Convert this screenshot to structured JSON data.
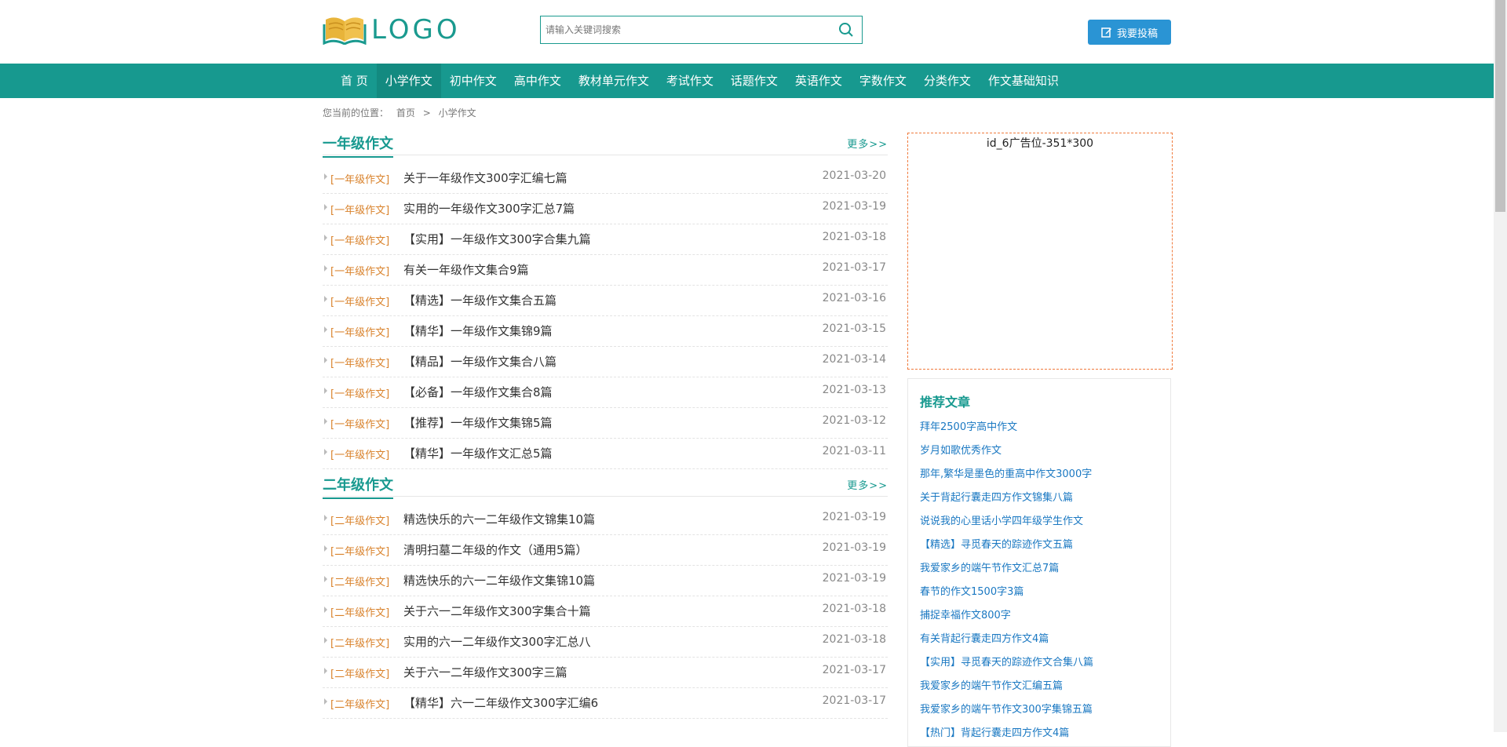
{
  "header": {
    "logo_text": "LOGO",
    "search_placeholder": "请输入关键词搜索",
    "submit_label": "我要投稿"
  },
  "nav": {
    "items": [
      "首 页",
      "小学作文",
      "初中作文",
      "高中作文",
      "教材单元作文",
      "考试作文",
      "话题作文",
      "英语作文",
      "字数作文",
      "分类作文",
      "作文基础知识"
    ],
    "active_index": 1
  },
  "breadcrumb": {
    "prefix": "您当前的位置：",
    "home": "首页",
    "sep": ">",
    "current": "小学作文"
  },
  "sections": [
    {
      "title": "一年级作文",
      "more": "更多>>",
      "tag": "[一年级作文]",
      "items": [
        {
          "title": "关于一年级作文300字汇编七篇",
          "date": "2021-03-20"
        },
        {
          "title": "实用的一年级作文300字汇总7篇",
          "date": "2021-03-19"
        },
        {
          "title": "【实用】一年级作文300字合集九篇",
          "date": "2021-03-18"
        },
        {
          "title": "有关一年级作文集合9篇",
          "date": "2021-03-17"
        },
        {
          "title": "【精选】一年级作文集合五篇",
          "date": "2021-03-16"
        },
        {
          "title": "【精华】一年级作文集锦9篇",
          "date": "2021-03-15"
        },
        {
          "title": "【精品】一年级作文集合八篇",
          "date": "2021-03-14"
        },
        {
          "title": "【必备】一年级作文集合8篇",
          "date": "2021-03-13"
        },
        {
          "title": "【推荐】一年级作文集锦5篇",
          "date": "2021-03-12"
        },
        {
          "title": "【精华】一年级作文汇总5篇",
          "date": "2021-03-11"
        }
      ]
    },
    {
      "title": "二年级作文",
      "more": "更多>>",
      "tag": "[二年级作文]",
      "items": [
        {
          "title": "精选快乐的六一二年级作文锦集10篇",
          "date": "2021-03-19"
        },
        {
          "title": "清明扫墓二年级的作文（通用5篇）",
          "date": "2021-03-19"
        },
        {
          "title": "精选快乐的六一二年级作文集锦10篇",
          "date": "2021-03-19"
        },
        {
          "title": "关于六一二年级作文300字集合十篇",
          "date": "2021-03-18"
        },
        {
          "title": "实用的六一二年级作文300字汇总八",
          "date": "2021-03-18"
        },
        {
          "title": "关于六一二年级作文300字三篇",
          "date": "2021-03-17"
        },
        {
          "title": "【精华】六一二年级作文300字汇编6",
          "date": "2021-03-17"
        }
      ]
    }
  ],
  "sidebar": {
    "ad_label": "id_6广告位-351*300",
    "recommend_title": "推荐文章",
    "recommend": [
      "拜年2500字高中作文",
      "岁月如歌优秀作文",
      "那年,繁华是墨色的重高中作文3000字",
      "关于背起行囊走四方作文锦集八篇",
      "说说我的心里话小学四年级学生作文",
      "【精选】寻觅春天的踪迹作文五篇",
      "我爱家乡的端午节作文汇总7篇",
      "春节的作文1500字3篇",
      "捕捉幸福作文800字",
      "有关背起行囊走四方作文4篇",
      "【实用】寻觅春天的踪迹作文合集八篇",
      "我爱家乡的端午节作文汇编五篇",
      "我爱家乡的端午节作文300字集锦五篇",
      "【热门】背起行囊走四方作文4篇"
    ]
  },
  "colors": {
    "brand": "#17998f",
    "tag": "#d9822b",
    "link": "#1a78c2",
    "button": "#2a94d4"
  }
}
